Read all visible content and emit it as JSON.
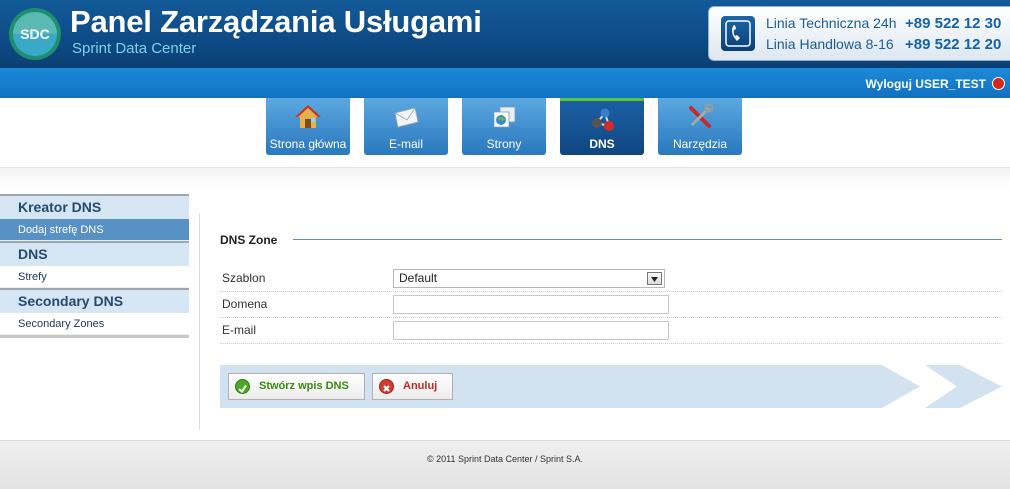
{
  "header": {
    "logo_text": "SDC",
    "title": "Panel Zarządzania Usługami",
    "subtitle": "Sprint Data Center",
    "contact": [
      {
        "label": "Linia Techniczna 24h",
        "phone": "+89 522 12 30"
      },
      {
        "label": "Linia Handlowa 8-16",
        "phone": "+89 522 12 20"
      }
    ]
  },
  "userbar": {
    "logout_label": "Wyloguj USER_TEST"
  },
  "tabs": [
    {
      "label": "Strona główna",
      "icon": "home-icon"
    },
    {
      "label": "E-mail",
      "icon": "envelope-icon"
    },
    {
      "label": "Strony",
      "icon": "web-pages-icon"
    },
    {
      "label": "DNS",
      "icon": "network-nodes-icon",
      "active": true
    },
    {
      "label": "Narzędzia",
      "icon": "tools-icon"
    }
  ],
  "sidebar": {
    "groups": [
      {
        "title": "Kreator DNS",
        "items": [
          "Dodaj strefę DNS"
        ]
      },
      {
        "title": "DNS",
        "items": [
          "Strefy"
        ]
      },
      {
        "title": "Secondary DNS",
        "items": [
          "Secondary Zones"
        ]
      }
    ]
  },
  "main": {
    "section_title": "DNS Zone",
    "form": {
      "szablon_label": "Szablon",
      "szablon_value": "Default",
      "domena_label": "Domena",
      "domena_value": "",
      "email_label": "E-mail",
      "email_value": ""
    },
    "create_button": "Stwórz wpis DNS",
    "cancel_button": "Anuluj"
  },
  "footer": {
    "copyright": "© 2011 Sprint Data Center / Sprint S.A."
  },
  "colors": {
    "brand_dark": "#0d4a85",
    "brand_light": "#1c8ad8",
    "accent_green": "#57c13a",
    "cancel_red": "#c0281f",
    "create_green": "#3a8a10"
  }
}
